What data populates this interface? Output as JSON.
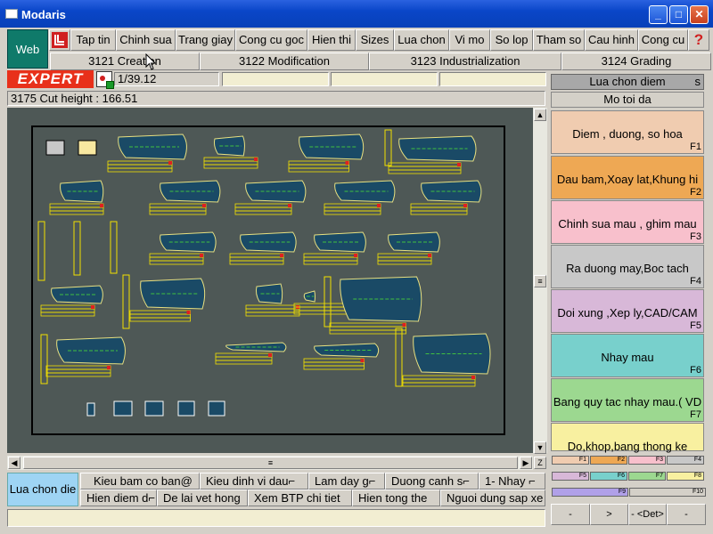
{
  "window": {
    "title": "Modaris",
    "minimize": "_",
    "maximize": "□",
    "close": "✕"
  },
  "web_label": "Web",
  "menu": [
    "Tap tin",
    "Chinh sua",
    "Trang giay",
    "Cong cu goc",
    "Hien thi",
    "Sizes",
    "Lua chon",
    "Vi mo",
    "So lop",
    "Tham so",
    "Cau hinh",
    "Cong cu"
  ],
  "help_label": "?",
  "tabs": [
    "3121 Creation",
    "3122 Modification",
    "3123 Industrialization",
    "3124 Grading"
  ],
  "expert_label": "EXPERT",
  "scale_value": "1/39.12",
  "status_text": "3175 Cut height : 166.51",
  "right_header": {
    "title": "Lua chon diem",
    "suffix": "s",
    "subtitle": "Mo toi da"
  },
  "fkeys": [
    {
      "label": "Diem , duong, so hoa",
      "key": "F1",
      "color": "#f0ccb0"
    },
    {
      "label": "Dau bam,Xoay lat,Khung hi",
      "key": "F2",
      "color": "#eea854"
    },
    {
      "label": "Chinh sua mau , ghim mau",
      "key": "F3",
      "color": "#f8c0cc"
    },
    {
      "label": "Ra duong may,Boc tach",
      "key": "F4",
      "color": "#c8c8c8"
    },
    {
      "label": "Doi xung ,Xep ly,CAD/CAM",
      "key": "F5",
      "color": "#d8b8d8"
    },
    {
      "label": "Nhay mau",
      "key": "F6",
      "color": "#78d0cc"
    },
    {
      "label": "Bang quy tac nhay mau.( VD",
      "key": "F7",
      "color": "#9cd890"
    },
    {
      "label": "Do,khop,bang thong ke",
      "key": "F8",
      "color": "#f8f0a0"
    }
  ],
  "mini_keys": [
    {
      "key": "F1",
      "color": "#f0ccb0"
    },
    {
      "key": "F2",
      "color": "#eea854"
    },
    {
      "key": "F3",
      "color": "#f8c0cc"
    },
    {
      "key": "F4",
      "color": "#c8c8c8"
    },
    {
      "key": "F5",
      "color": "#d8b8d8"
    },
    {
      "key": "F6",
      "color": "#78d0cc"
    },
    {
      "key": "F7",
      "color": "#9cd890"
    },
    {
      "key": "F8",
      "color": "#f8f0a0"
    },
    {
      "key": "F9",
      "color": "#b0a0e8"
    },
    {
      "key": "F10",
      "color": "#d4d0c8"
    }
  ],
  "bottom_main": "Lua chon die",
  "bottom_row1": [
    "Kieu bam co ban@",
    "Kieu dinh vi dau⌐",
    "Lam day g⌐",
    "Duong canh s⌐",
    "1- Nhay ⌐"
  ],
  "bottom_row2": [
    "Hien diem d⌐",
    "De lai vet hong",
    "Xem BTP chi tiet",
    "Hien tong the",
    "Nguoi dung sap xe"
  ],
  "nav_buttons": [
    "-",
    ">",
    "- <Det>",
    "-"
  ],
  "scroll": {
    "up": "▲",
    "down": "▼",
    "left": "◀",
    "right": "▶",
    "z": "Z",
    "grip": "≡"
  },
  "colors": {
    "piece": "#1a4a66",
    "piece_line": "#e8e080",
    "label_box": "#f2e000",
    "canvas_bg": "#4e5856"
  }
}
